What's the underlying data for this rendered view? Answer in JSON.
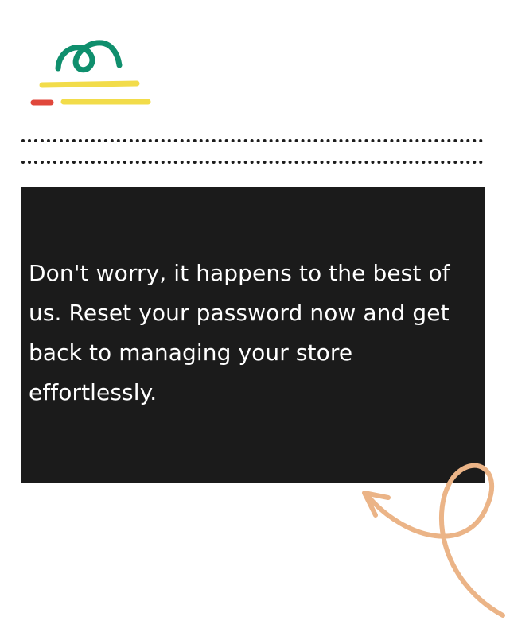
{
  "message": {
    "text": "Don't worry, it happens to the best of us. Reset your password now and get back to managing your store effortlessly."
  },
  "colors": {
    "panel_background": "#1b1b1b",
    "text": "#ffffff",
    "logo_green": "#0f8f6d",
    "logo_yellow": "#f2dc4a",
    "logo_red": "#e0473b",
    "swirl_arrow": "#ebb487"
  },
  "icons": {
    "logo": "loop-scribble-logo-icon",
    "decoration": "curved-arrow-decoration-icon"
  }
}
